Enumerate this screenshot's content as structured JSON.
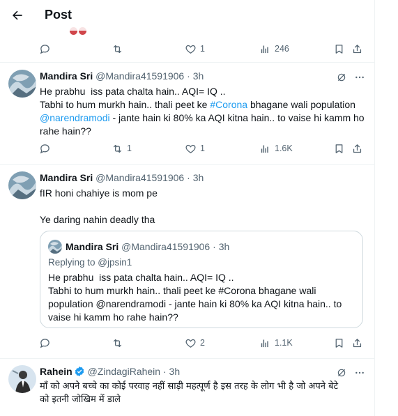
{
  "header": {
    "title": "Post"
  },
  "main_post": {
    "replies": "",
    "reposts": "",
    "likes": "1",
    "views": "246"
  },
  "replies": [
    {
      "name": "Mandira Sri",
      "handle": "@Mandira41591906",
      "dot": "·",
      "time": "3h",
      "text_1": "He prabhu  iss pata chalta hain.. AQI= IQ ..\nTabhi to hum murkh hain.. thali peet ke ",
      "hashtag": "#Corona",
      "text_2": " bhagane wali population\n",
      "mention": "@narendramodi",
      "text_3": " - jante hain ki 80% ka AQI kitna hain.. to vaise hi kamm ho rahe hain??",
      "stats": {
        "replies": "",
        "reposts": "1",
        "likes": "1",
        "views": "1.6K"
      }
    },
    {
      "name": "Mandira Sri",
      "handle": "@Mandira41591906",
      "dot": "·",
      "time": "3h",
      "text": "fIR honi chahiye is mom pe\n\nYe daring nahin deadly tha",
      "quote": {
        "name": "Mandira Sri",
        "handle": "@Mandira41591906",
        "dot": "·",
        "time": "3h",
        "replying_to": "Replying to @jpsin1",
        "text": "He prabhu  iss pata chalta hain.. AQI= IQ ..\nTabhi to hum murkh hain.. thali peet ke #Corona bhagane wali\npopulation @narendramodi - jante hain ki 80% ka AQI kitna hain.. to\nvaise hi kamm ho rahe hain??"
      },
      "stats": {
        "replies": "",
        "reposts": "",
        "likes": "2",
        "views": "1.1K"
      }
    },
    {
      "name": "Rahein",
      "handle": "@ZindagiRahein",
      "dot": "·",
      "time": "3h",
      "text": "माँ को अपने बच्चे का कोई परवाह नहीं साड़ी महत्पूर्ण है इस तरह के लोग भी है जो अपने बेटे\nको इतनी जोखिम में डाले"
    }
  ],
  "colors": {
    "accent": "#1d9bf0",
    "muted": "#536471",
    "text": "#0f1419",
    "verified": "#1d9bf0"
  },
  "icons": [
    "back-arrow-icon",
    "reply-icon",
    "repost-icon",
    "like-icon",
    "views-icon",
    "bookmark-icon",
    "share-icon",
    "grok-icon",
    "more-icon",
    "verified-icon"
  ]
}
